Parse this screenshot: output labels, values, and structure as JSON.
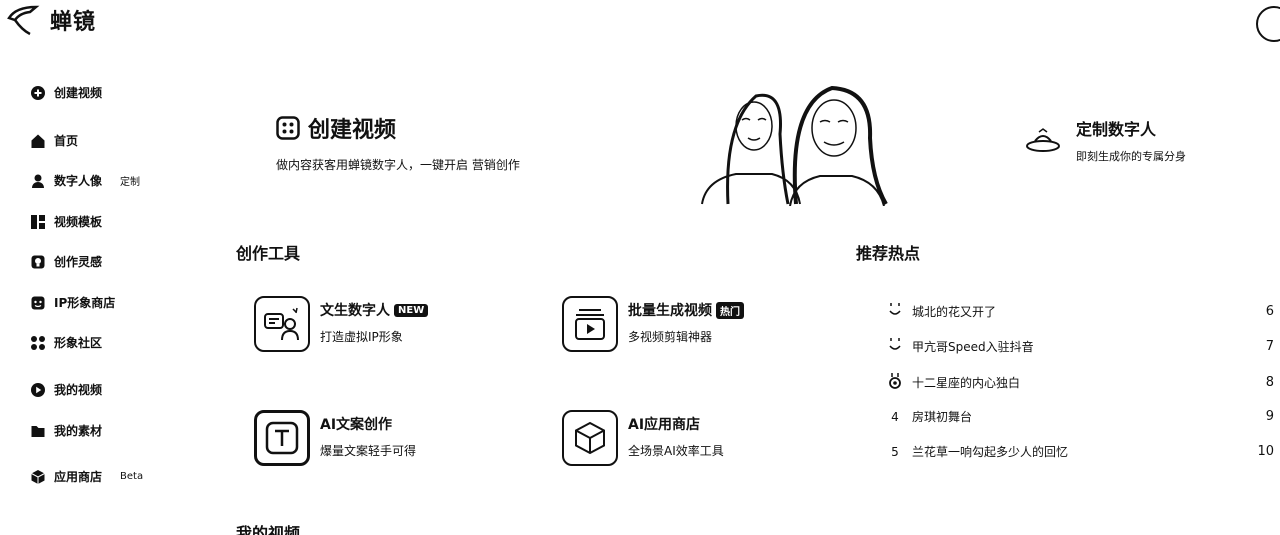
{
  "app": {
    "name": "蝉镜"
  },
  "sidebar": {
    "items": [
      {
        "label": "创建视频",
        "tag": ""
      },
      {
        "label": "首页",
        "tag": ""
      },
      {
        "label": "数字人像",
        "tag": "定制"
      },
      {
        "label": "视频模板",
        "tag": ""
      },
      {
        "label": "创作灵感",
        "tag": ""
      },
      {
        "label": "IP形象商店",
        "tag": ""
      },
      {
        "label": "形象社区",
        "tag": ""
      },
      {
        "label": "我的视频",
        "tag": ""
      },
      {
        "label": "我的素材",
        "tag": ""
      },
      {
        "label": "应用商店",
        "tag": "Beta"
      }
    ]
  },
  "hero": {
    "create_title": "创建视频",
    "create_desc": "做内容获客用蝉镜数字人，一键开启 营销创作",
    "custom_title": "定制数字人",
    "custom_desc": "即刻生成你的专属分身"
  },
  "tools": {
    "section_title": "创作工具",
    "items": [
      {
        "name": "文生数字人",
        "badge": "NEW",
        "desc": "打造虚拟IP形象",
        "icon": "avatar-chat-icon"
      },
      {
        "name": "批量生成视频",
        "badge": "热门",
        "desc": "多视频剪辑神器",
        "icon": "video-stack-icon"
      },
      {
        "name": "AI文案创作",
        "badge": "",
        "desc": "爆量文案轻手可得",
        "icon": "text-t-icon"
      },
      {
        "name": "AI应用商店",
        "badge": "",
        "desc": "全场景AI效率工具",
        "icon": "cube-icon"
      }
    ]
  },
  "hot": {
    "section_title": "推荐热点",
    "items": [
      {
        "rank": "",
        "text": "城北的花又开了",
        "num": "6"
      },
      {
        "rank": "",
        "text": "甲亢哥Speed入驻抖音",
        "num": "7"
      },
      {
        "rank": "",
        "text": "十二星座的内心独白",
        "num": "8"
      },
      {
        "rank": "4",
        "text": "房琪初舞台",
        "num": "9"
      },
      {
        "rank": "5",
        "text": "兰花草一响勾起多少人的回忆",
        "num": "10"
      }
    ]
  },
  "my_videos": {
    "title": "我的视频"
  }
}
